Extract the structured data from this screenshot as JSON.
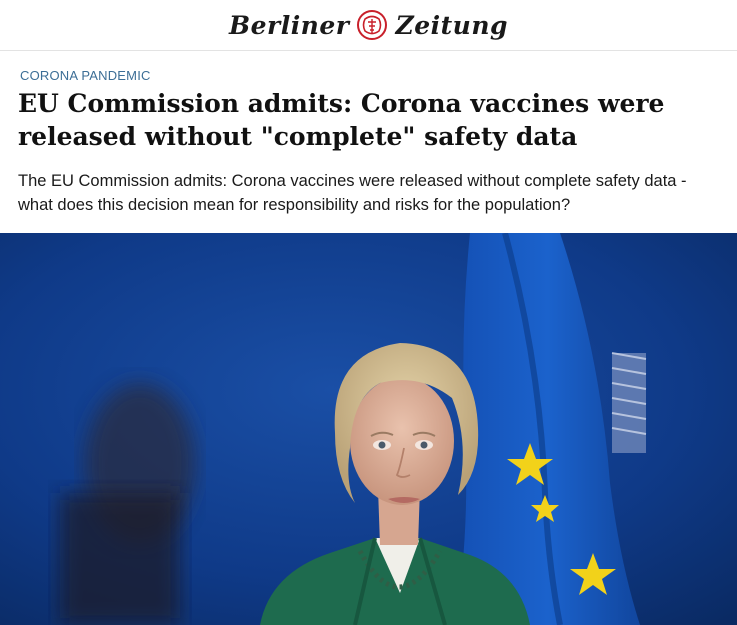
{
  "masthead": {
    "brand_left": "Berliner",
    "brand_right": "Zeitung"
  },
  "article": {
    "kicker": "CORONA PANDEMIC",
    "headline": "EU Commission admits: Corona vaccines were released without \"complete\" safety data",
    "subhead": "The EU Commission admits: Corona vaccines were released without complete safety data - what does this decision mean for responsibility and risks for the population?"
  },
  "colors": {
    "kicker": "#3c6e96",
    "photo_background": "#0f3a88",
    "eu_flag": "#1450b4",
    "eu_star": "#f2d21a",
    "jacket": "#1e6b4e",
    "seal_red": "#c8202a"
  },
  "icons": {
    "masthead_seal": "berliner-bear-seal-icon"
  }
}
